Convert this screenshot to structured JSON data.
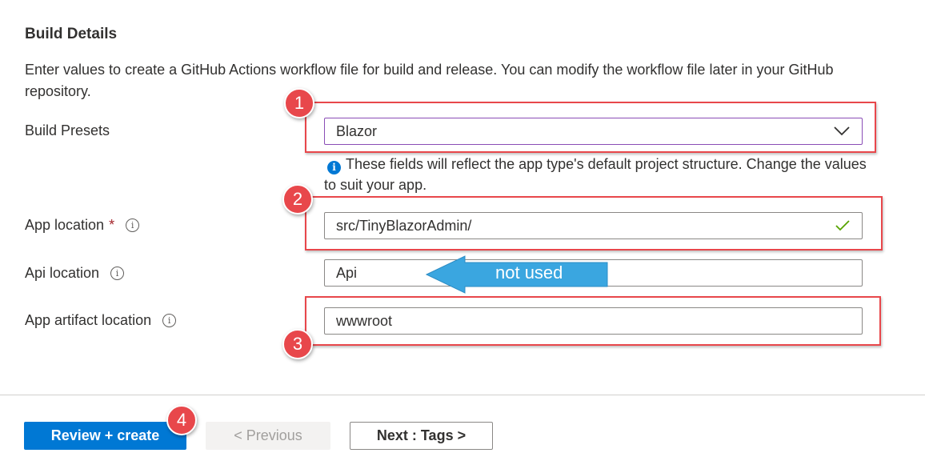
{
  "section": {
    "title": "Build Details",
    "description": "Enter values to create a GitHub Actions workflow file for build and release. You can modify the workflow file later in your GitHub repository."
  },
  "form": {
    "build_presets": {
      "label": "Build Presets",
      "value": "Blazor"
    },
    "hint": {
      "icon": "info-icon",
      "text": "These fields will reflect the app type's default project structure. Change the values to suit your app."
    },
    "app_location": {
      "label": "App location",
      "required_mark": "*",
      "value": "src/TinyBlazorAdmin/"
    },
    "api_location": {
      "label": "Api location",
      "value": "Api"
    },
    "artifact_location": {
      "label": "App artifact location",
      "value": "wwwroot"
    }
  },
  "annotations": {
    "markers": [
      "1",
      "2",
      "3",
      "4"
    ],
    "callout": "not used",
    "highlight_color": "#e8474b",
    "callout_color": "#3aa6e0"
  },
  "footer": {
    "review_create": "Review + create",
    "previous": "< Previous",
    "next": "Next : Tags >"
  },
  "colors": {
    "primary": "#0078d4",
    "text": "#323130",
    "valid": "#57a300"
  }
}
